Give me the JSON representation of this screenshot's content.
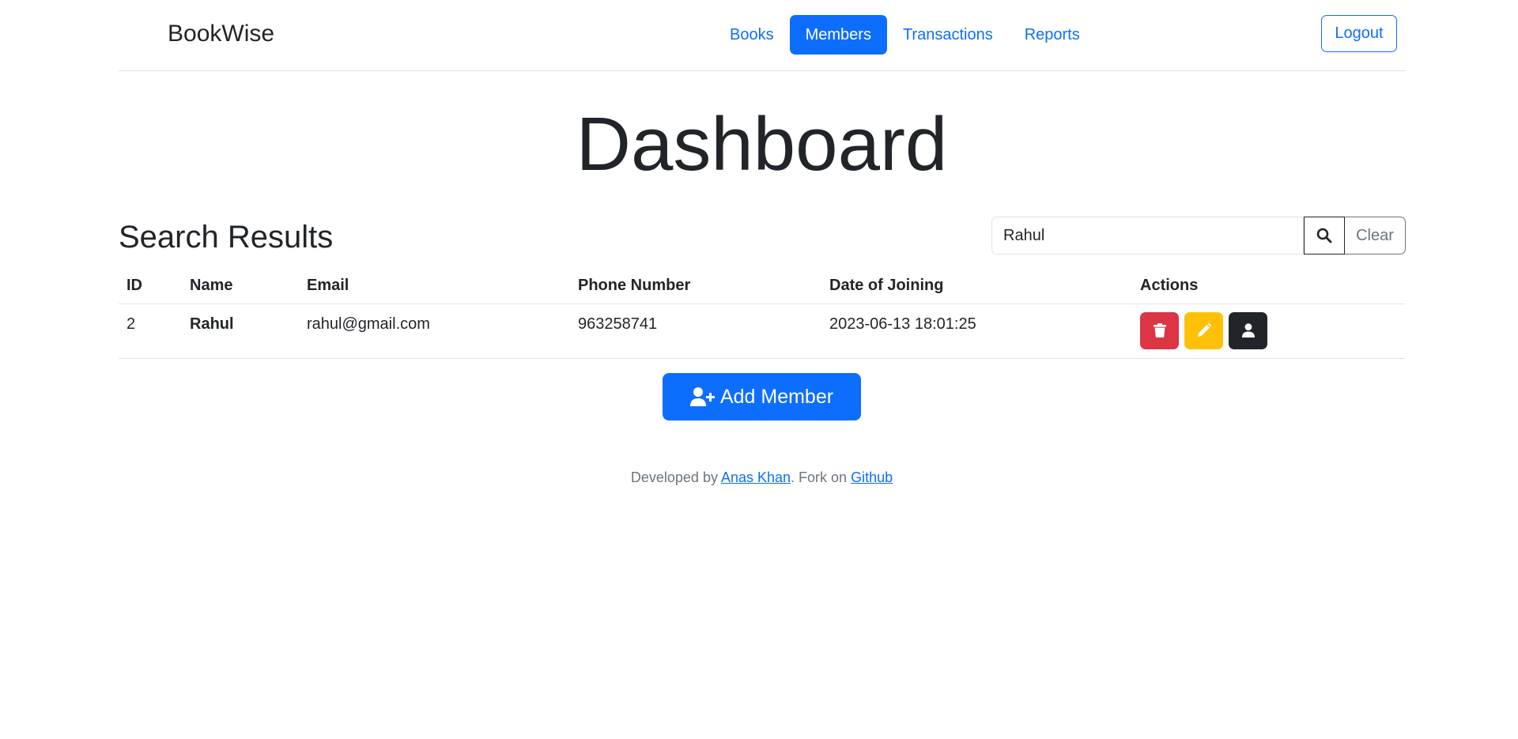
{
  "header": {
    "brand": "BookWise",
    "nav": [
      {
        "label": "Books",
        "active": false
      },
      {
        "label": "Members",
        "active": true
      },
      {
        "label": "Transactions",
        "active": false
      },
      {
        "label": "Reports",
        "active": false
      }
    ],
    "logout_label": "Logout"
  },
  "main": {
    "title": "Dashboard",
    "section_title": "Search Results",
    "search": {
      "value": "Rahul",
      "button_icon": "search-icon",
      "clear_label": "Clear"
    },
    "table": {
      "columns": [
        "ID",
        "Name",
        "Email",
        "Phone Number",
        "Date of Joining",
        "Actions"
      ],
      "rows": [
        {
          "id": "2",
          "name": "Rahul",
          "email": "rahul@gmail.com",
          "phone": "963258741",
          "joined": "2023-06-13 18:01:25",
          "actions": [
            "trash-icon",
            "pencil-icon",
            "user-icon"
          ]
        }
      ]
    },
    "add_member_label": "Add Member"
  },
  "footer": {
    "prefix": "Developed by ",
    "author": "Anas Khan",
    "middle": ". Fork on ",
    "repo": "Github"
  },
  "colors": {
    "primary": "#0d6efd",
    "danger": "#dc3545",
    "warning": "#ffc107",
    "dark": "#212529",
    "secondary": "#6c757d"
  }
}
